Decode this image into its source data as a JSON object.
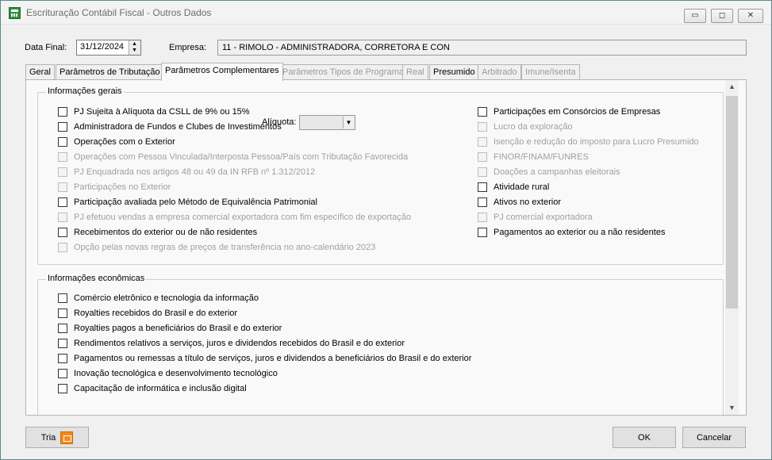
{
  "window": {
    "title": "Escrituração Contábil Fiscal - Outros Dados",
    "controls": {
      "minimize": "▭",
      "maximize": "◻",
      "close": "✕"
    }
  },
  "header": {
    "data_final_label": "Data Final:",
    "data_final_value": "31/12/2024",
    "empresa_label": "Empresa:",
    "empresa_value": "11 - RIMOLO - ADMINISTRADORA, CORRETORA E CON"
  },
  "tabs": [
    {
      "label": "Geral",
      "state": "normal"
    },
    {
      "label": "Parâmetros de Tributação",
      "state": "normal"
    },
    {
      "label": "Parâmetros Complementares",
      "state": "active"
    },
    {
      "label": "Parâmetros Tipos de Programa",
      "state": "disabled"
    },
    {
      "label": "Real",
      "state": "disabled"
    },
    {
      "label": "Presumido",
      "state": "normal"
    },
    {
      "label": "Arbitrado",
      "state": "disabled"
    },
    {
      "label": "Imune/Isenta",
      "state": "disabled"
    }
  ],
  "informacoes_gerais": {
    "title": "Informações gerais",
    "aliquota_label": "Alíquota:",
    "aliquota_value": "",
    "left": [
      {
        "label": "PJ Sujeita à Alíquota da CSLL de 9% ou 15%",
        "enabled": true
      },
      {
        "label": "Administradora de Fundos e Clubes de Investimentos",
        "enabled": true
      },
      {
        "label": "Operações com o Exterior",
        "enabled": true
      },
      {
        "label": "Operações com Pessoa Vinculada/Interposta Pessoa/País com Tributação Favorecida",
        "enabled": false
      },
      {
        "label": "PJ Enquadrada nos artigos 48 ou 49 da IN RFB nº 1.312/2012",
        "enabled": false
      },
      {
        "label": "Participações no Exterior",
        "enabled": false
      },
      {
        "label": "Participação avaliada pelo Método de Equivalência Patrimonial",
        "enabled": true
      },
      {
        "label": "PJ efetuou vendas a empresa comercial exportadora com fim específico de exportação",
        "enabled": false
      },
      {
        "label": "Recebimentos do exterior ou de não residentes",
        "enabled": true
      },
      {
        "label": "Opção pelas novas regras de preços de transferência no ano-calendário 2023",
        "enabled": false
      }
    ],
    "right": [
      {
        "label": "Participações em Consórcios de Empresas",
        "enabled": true
      },
      {
        "label": "Lucro da exploração",
        "enabled": false
      },
      {
        "label": "Isenção e redução do imposto para Lucro Presumido",
        "enabled": false
      },
      {
        "label": "FINOR/FINAM/FUNRES",
        "enabled": false
      },
      {
        "label": "Doações a campanhas eleitorais",
        "enabled": false
      },
      {
        "label": "Atividade rural",
        "enabled": true
      },
      {
        "label": "Ativos no exterior",
        "enabled": true
      },
      {
        "label": "PJ comercial exportadora",
        "enabled": false
      },
      {
        "label": "Pagamentos ao exterior ou a não residentes",
        "enabled": true
      }
    ]
  },
  "informacoes_economicas": {
    "title": "Informações econômicas",
    "items": [
      {
        "label": "Comércio eletrônico e tecnologia da informação",
        "enabled": true
      },
      {
        "label": "Royalties recebidos do Brasil e do exterior",
        "enabled": true
      },
      {
        "label": "Royalties pagos a beneficiários do Brasil e do exterior",
        "enabled": true
      },
      {
        "label": "Rendimentos relativos a serviços, juros e dividendos recebidos do Brasil e do exterior",
        "enabled": true
      },
      {
        "label": "Pagamentos ou remessas a título de serviços, juros e dividendos a beneficiários do Brasil e do exterior",
        "enabled": true
      },
      {
        "label": "Inovação tecnológica e desenvolvimento tecnológico",
        "enabled": true
      },
      {
        "label": "Capacitação de informática e inclusão digital",
        "enabled": true
      }
    ]
  },
  "buttons": {
    "tria": "Tria",
    "ok": "OK",
    "cancelar": "Cancelar"
  }
}
